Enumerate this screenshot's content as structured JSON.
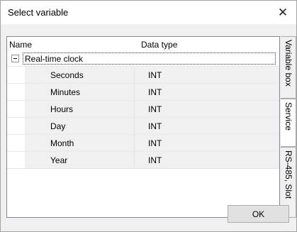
{
  "window": {
    "title": "Select variable",
    "close_glyph": "✕"
  },
  "tree": {
    "columns": {
      "name": "Name",
      "type": "Data type"
    },
    "group": {
      "label": "Real-time clock",
      "expanded": true
    },
    "items": [
      {
        "name": "Seconds",
        "type": "INT"
      },
      {
        "name": "Minutes",
        "type": "INT"
      },
      {
        "name": "Hours",
        "type": "INT"
      },
      {
        "name": "Day",
        "type": "INT"
      },
      {
        "name": "Month",
        "type": "INT"
      },
      {
        "name": "Year",
        "type": "INT"
      }
    ]
  },
  "tabs": [
    {
      "label": "Variable box",
      "active": false
    },
    {
      "label": "Service",
      "active": true
    },
    {
      "label": "RS-485, Slot",
      "active": false
    }
  ],
  "footer": {
    "ok_label": "OK"
  }
}
